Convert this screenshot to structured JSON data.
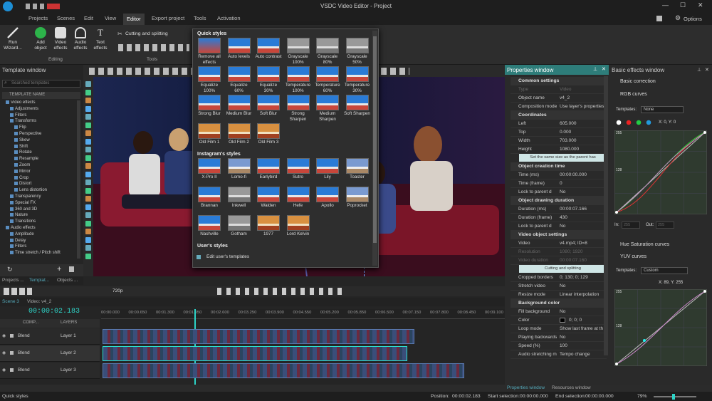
{
  "app": {
    "title": "VSDC Video Editor - Project",
    "options_label": "Options"
  },
  "menu": [
    "Projects",
    "Scenes",
    "Edit",
    "View",
    "Editor",
    "Export project",
    "Tools",
    "Activation"
  ],
  "menu_active": "Editor",
  "ribbon": {
    "run_wizard": "Run Wizard...",
    "add_object": "Add object",
    "video_effects": "Video effects",
    "audio_effects": "Audio effects",
    "text_effects": "Text effects",
    "editing_group": "Editing",
    "cutting_splitting": "Cutting and splitting",
    "tools_group": "Tools"
  },
  "template_window": {
    "title": "Template window",
    "search_placeholder": "Searched templates",
    "column": "TEMPLATE NAME",
    "items": [
      "Video effects",
      "Adjustments",
      "Filters",
      "Transforms",
      "Flip",
      "Perspective",
      "Skew",
      "Shift",
      "Rotate",
      "Resample",
      "Zoom",
      "Mirror",
      "Crop",
      "Distort",
      "Lens distortion",
      "Transparency",
      "Special FX",
      "360 and 3D",
      "Nature",
      "Transitions",
      "Audio effects",
      "Amplitude",
      "Delay",
      "Filters",
      "Time stretch / Pitch shift"
    ]
  },
  "quick_styles": {
    "header": "Quick styles",
    "items": [
      "Remove all effects",
      "Auto levels",
      "Auto contrast",
      "Grayscale 100%",
      "Grayscale 80%",
      "Grayscale 50%",
      "Equalize 100%",
      "Equalize 60%",
      "Equalize 30%",
      "Temperature 100%",
      "Temperature 60%",
      "Temperature 30%",
      "Strong Blur",
      "Medium Blur",
      "Soft Blur",
      "Strong Sharpen",
      "Medium Sharpen",
      "Soft Sharpen",
      "Old Film 1",
      "Old Film 2",
      "Old Film 3"
    ],
    "instagram_header": "Instagram's styles",
    "instagram": [
      "X-Pro II",
      "Lomo-fi",
      "Earlybird",
      "Sutro",
      "Lily",
      "Toaster",
      "Brannan",
      "Inkwell",
      "Walden",
      "Hefe",
      "Apollo",
      "Poprocket",
      "Nashville",
      "Gotham",
      "1977",
      "Lord Kelvin"
    ],
    "user_header": "User's styles",
    "edit_templates": "Edit user's templates"
  },
  "properties": {
    "title": "Properties window",
    "common": "Common settings",
    "type_k": "Type",
    "type_v": "Video",
    "name_k": "Object name",
    "name_v": "v4_2",
    "comp_k": "Composition mode",
    "comp_v": "Use layer's properties",
    "coords": "Coordinates",
    "left_k": "Left",
    "left_v": "605.000",
    "top_k": "Top",
    "top_v": "0.000",
    "width_k": "Width",
    "width_v": "703.000",
    "height_k": "Height",
    "height_v": "1080.000",
    "same_size": "Set the same size as the parent has",
    "creation": "Object creation time",
    "tms_k": "Time (ms)",
    "tms_v": "00:00:00.000",
    "tfr_k": "Time (frame)",
    "tfr_v": "0",
    "lock1_k": "Lock to parent d",
    "lock1_v": "No",
    "drawing": "Object drawing duration",
    "dms_k": "Duration (ms)",
    "dms_v": "00:00:07.166",
    "dfr_k": "Duration (frame)",
    "dfr_v": "430",
    "lock2_k": "Lock to parent d",
    "lock2_v": "No",
    "vos": "Video object settings",
    "video_k": "Video",
    "video_v": "v4.mp4; ID=8",
    "res_k": "Resolution",
    "res_v": "1080; 1920",
    "vdur_k": "Video duration",
    "vdur_v": "00:00:07.160",
    "cut_split": "Cutting and splitting",
    "crop_k": "Cropped borders",
    "crop_v": "0; 130; 0; 129",
    "stretch_k": "Stretch video",
    "stretch_v": "No",
    "resize_k": "Resize mode",
    "resize_v": "Linear interpolation",
    "bg": "Background color",
    "fill_k": "Fill background",
    "fill_v": "No",
    "color_k": "Color",
    "color_v": "0; 0; 0",
    "loop_k": "Loop mode",
    "loop_v": "Show last frame at th",
    "play_k": "Playing backwards",
    "play_v": "No",
    "speed_k": "Speed (%)",
    "speed_v": "100",
    "astretch_k": "Audio stretching m",
    "astretch_v": "Tempo change",
    "tab1": "Properties window",
    "tab2": "Resources window"
  },
  "effects": {
    "title": "Basic effects window",
    "basic": "Basic correction",
    "rgb": "RGB curves",
    "templates_lbl": "Templates:",
    "templates_val": "None",
    "coord": "X: 0, Y: 0",
    "y255": "255",
    "y128": "128",
    "in_lbl": "In:",
    "in_v": "255",
    "out_lbl": "Out:",
    "out_v": "255",
    "hue": "Hue Saturation curves",
    "yuv": "YUV curves",
    "templates_val2": "Custom",
    "coord2": "X: 89, Y: 255",
    "y255b": "255",
    "y128b": "128"
  },
  "timeline": {
    "tabs": [
      "Projects ...",
      "Templat...",
      "Objects ..."
    ],
    "resolution": "720p",
    "scene_tab": "Scene 3",
    "obj_tab": "Video: v4_2",
    "timecode": "00:00:02.183",
    "comp": "COMP...",
    "layers": "LAYERS",
    "ticks": [
      "00:00.000",
      "00:00.650",
      "00:01.300",
      "00:01.950",
      "00:02.600",
      "00:03.250",
      "00:03.900",
      "00:04.550",
      "00:05.200",
      "00:05.850",
      "00:06.500",
      "00:07.150",
      "00:07.800",
      "00:08.450",
      "00:09.100"
    ],
    "rows": [
      {
        "blend": "Blend",
        "name": "Layer 1"
      },
      {
        "blend": "Blend",
        "name": "Layer 2"
      },
      {
        "blend": "Blend",
        "name": "Layer 3"
      }
    ]
  },
  "status": {
    "left": "Quick styles",
    "position_lbl": "Position:",
    "position": "00:00:02.183",
    "start_lbl": "Start selection:",
    "start": "00:00:00.000",
    "end_lbl": "End selection:",
    "end": "00:00:00.000",
    "zoom": "79%"
  }
}
